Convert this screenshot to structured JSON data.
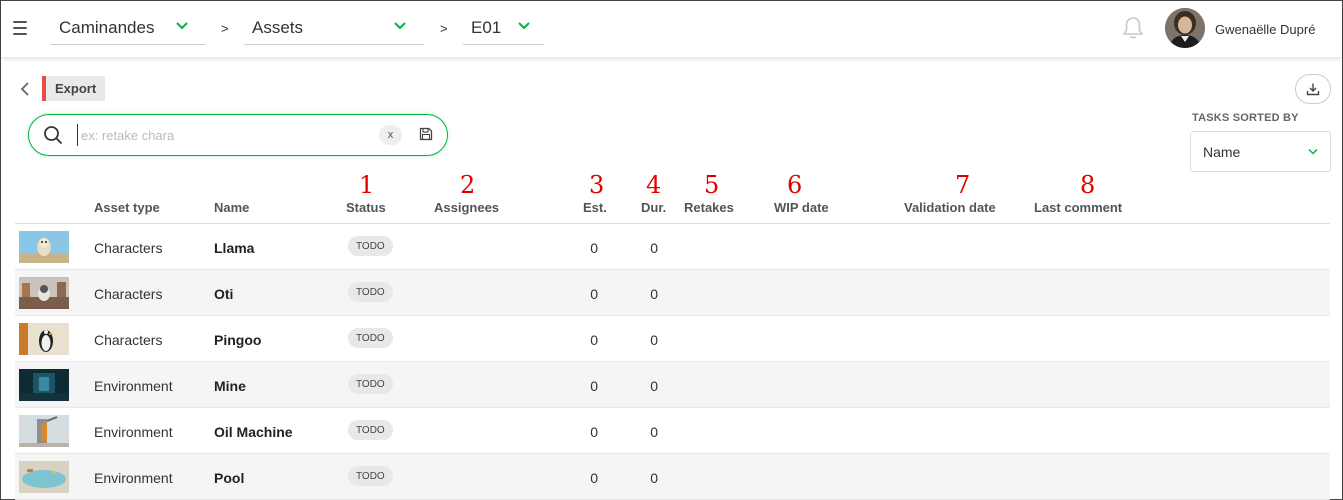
{
  "topbar": {
    "production": "Caminandes",
    "section": "Assets",
    "episode": "E01",
    "separator": ">",
    "user_name": "Gwenaëlle Dupré"
  },
  "page": {
    "export_label": "Export",
    "search_placeholder": "ex: retake chara",
    "clear_label": "x",
    "sort_label": "TASKS SORTED BY",
    "sort_value": "Name"
  },
  "annotations": [
    "1",
    "2",
    "3",
    "4",
    "5",
    "6",
    "7",
    "8"
  ],
  "table": {
    "headers": {
      "asset_type": "Asset type",
      "name": "Name",
      "status": "Status",
      "assignees": "Assignees",
      "est": "Est.",
      "dur": "Dur.",
      "retakes": "Retakes",
      "wip_date": "WIP date",
      "validation_date": "Validation date",
      "last_comment": "Last comment"
    },
    "rows": [
      {
        "asset_type": "Characters",
        "name": "Llama",
        "status": "TODO",
        "est": "0",
        "dur": "0"
      },
      {
        "asset_type": "Characters",
        "name": "Oti",
        "status": "TODO",
        "est": "0",
        "dur": "0"
      },
      {
        "asset_type": "Characters",
        "name": "Pingoo",
        "status": "TODO",
        "est": "0",
        "dur": "0"
      },
      {
        "asset_type": "Environment",
        "name": "Mine",
        "status": "TODO",
        "est": "0",
        "dur": "0"
      },
      {
        "asset_type": "Environment",
        "name": "Oil Machine",
        "status": "TODO",
        "est": "0",
        "dur": "0"
      },
      {
        "asset_type": "Environment",
        "name": "Pool",
        "status": "TODO",
        "est": "0",
        "dur": "0"
      }
    ]
  },
  "colors": {
    "accent_green": "#00b242",
    "export_marker": "#e64a4a",
    "annotation_red": "#e00000"
  }
}
